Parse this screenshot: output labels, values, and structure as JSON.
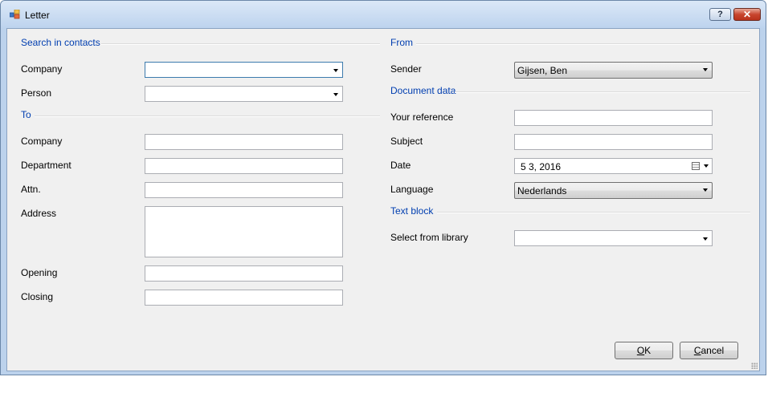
{
  "window": {
    "title": "Letter",
    "help_label": "?",
    "close_label": "✕"
  },
  "groups": {
    "search": "Search in contacts",
    "to": "To",
    "from": "From",
    "document": "Document data",
    "textblock": "Text block"
  },
  "search": {
    "company_label": "Company",
    "company_value": "",
    "person_label": "Person",
    "person_value": ""
  },
  "to": {
    "company_label": "Company",
    "company_value": "",
    "department_label": "Department",
    "department_value": "",
    "attn_label": "Attn.",
    "attn_value": "",
    "address_label": "Address",
    "address_value": "",
    "opening_label": "Opening",
    "opening_value": "",
    "closing_label": "Closing",
    "closing_value": ""
  },
  "from": {
    "sender_label": "Sender",
    "sender_value": "Gijsen, Ben"
  },
  "document": {
    "reference_label": "Your reference",
    "reference_value": "",
    "subject_label": "Subject",
    "subject_value": "",
    "date_label": "Date",
    "date_value": "5   3, 2016",
    "language_label": "Language",
    "language_value": "Nederlands"
  },
  "textblock": {
    "library_label": "Select from library",
    "library_value": ""
  },
  "buttons": {
    "ok_accel": "O",
    "ok_rest": "K",
    "cancel_accel": "C",
    "cancel_rest": "ancel"
  },
  "icons": {
    "app": "window-app-icon",
    "calendar": "calendar-icon",
    "dropdown": "chevron-down-icon"
  }
}
